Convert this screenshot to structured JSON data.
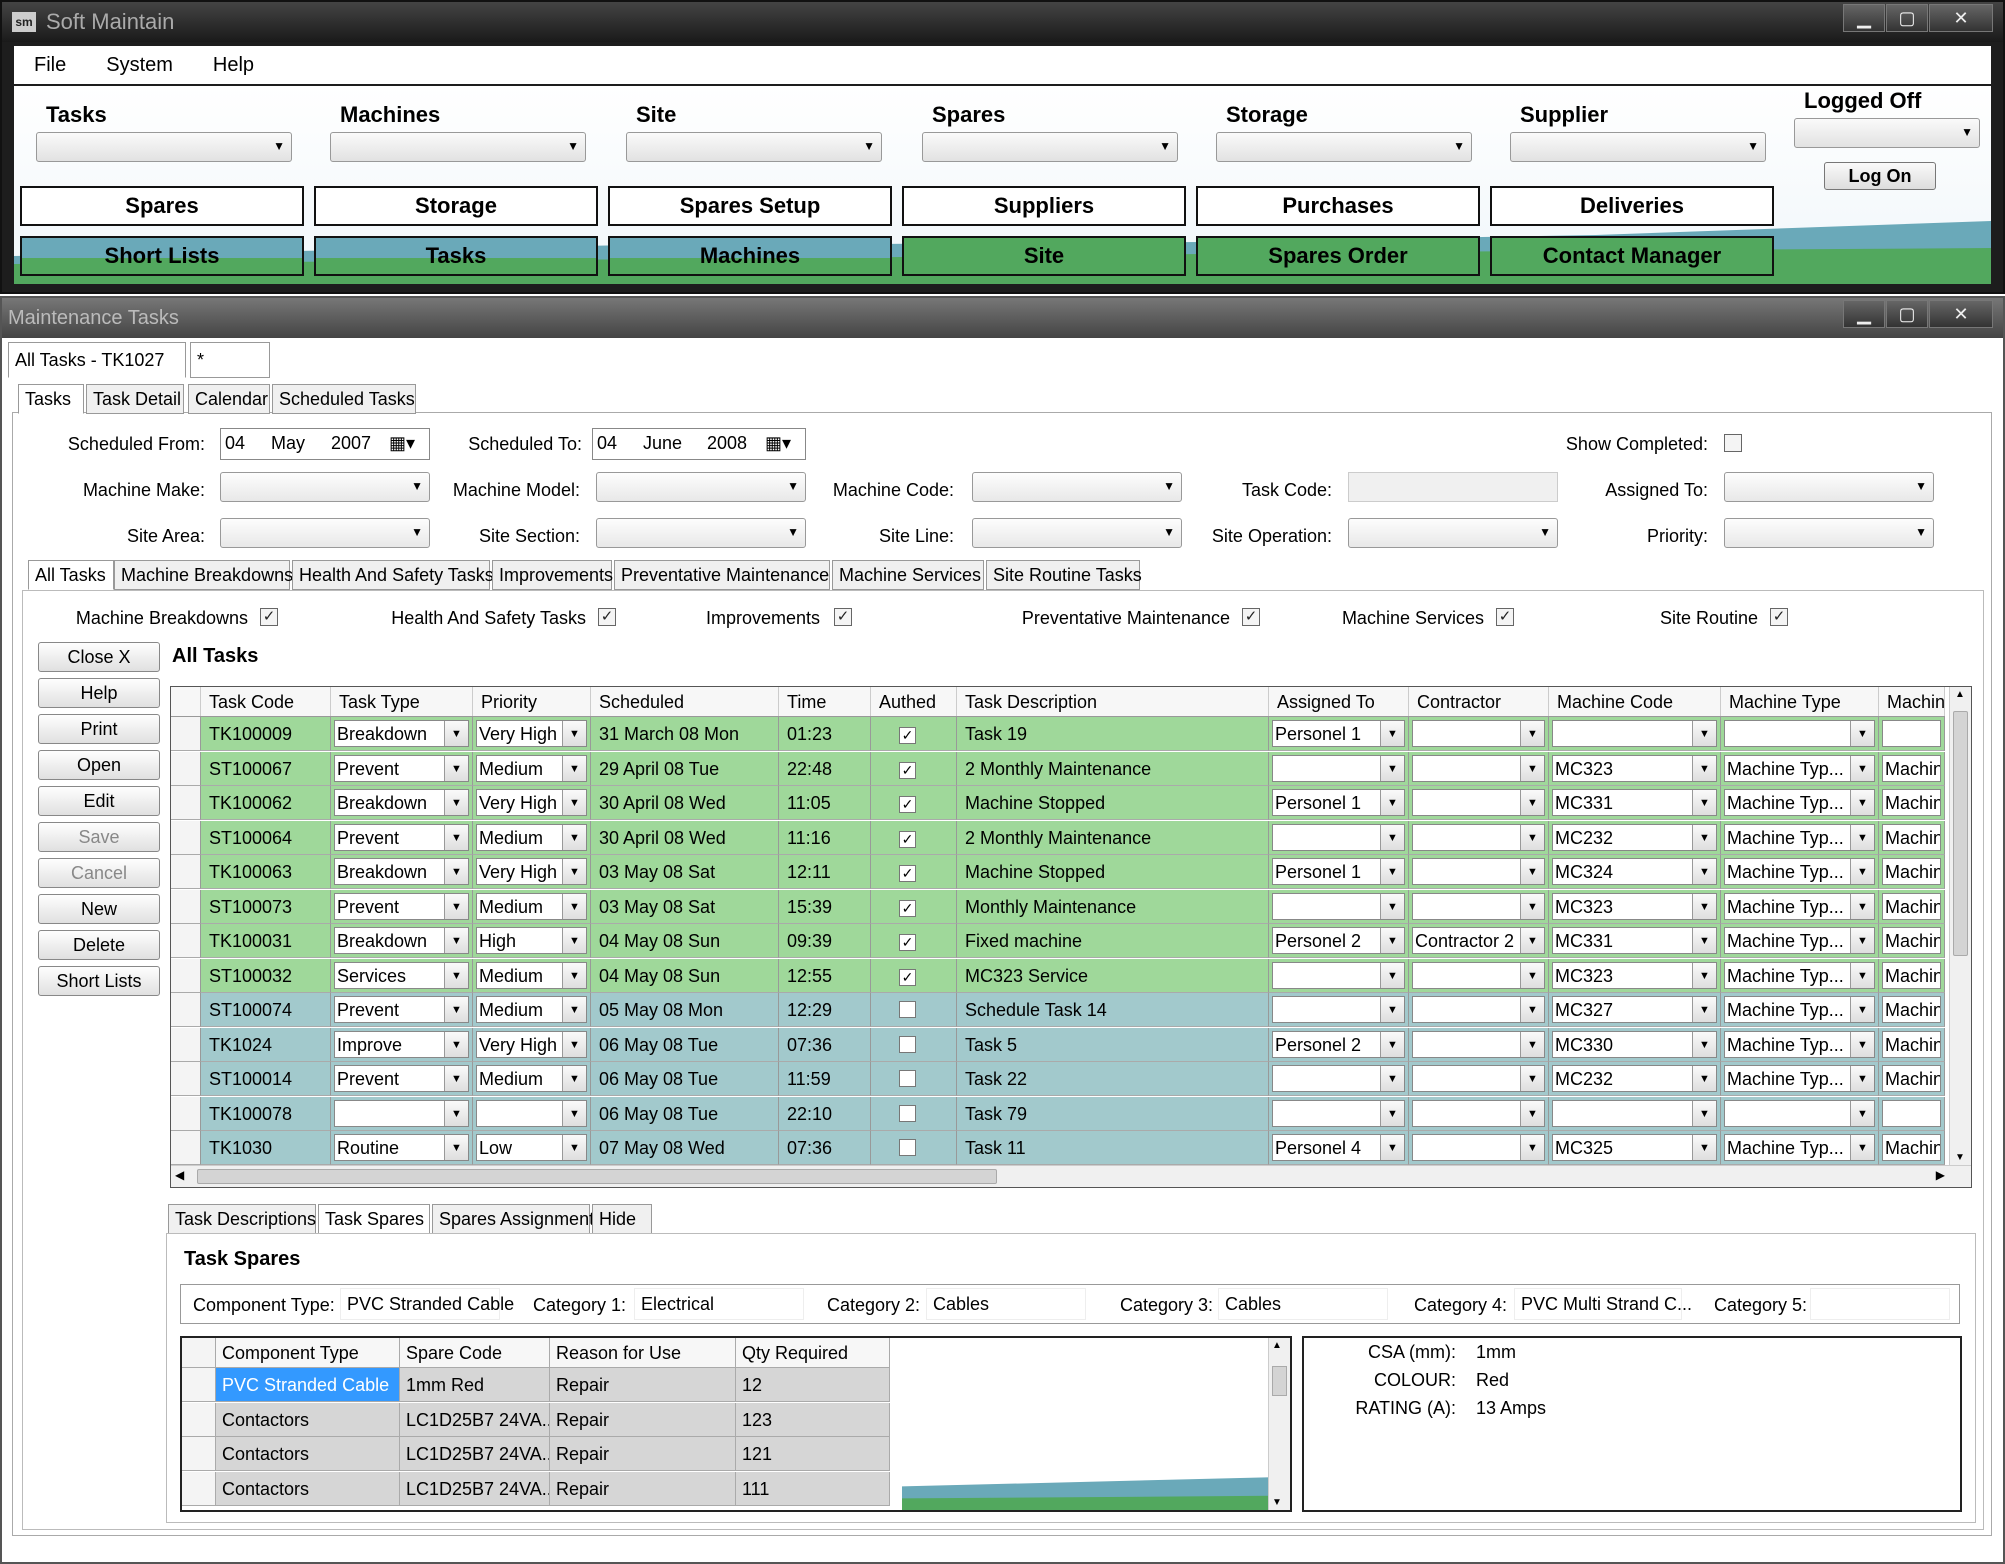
{
  "app": {
    "title": "Soft Maintain",
    "icon": "sm"
  },
  "menu": [
    "File",
    "System",
    "Help"
  ],
  "top": {
    "dropdowns": [
      "Tasks",
      "Machines",
      "Site",
      "Spares",
      "Storage",
      "Supplier"
    ],
    "logged_label": "Logged Off",
    "logon_button": "Log On",
    "row1": [
      "Spares",
      "Storage",
      "Spares Setup",
      "Suppliers",
      "Purchases",
      "Deliveries"
    ],
    "row2": [
      "Short Lists",
      "Tasks",
      "Machines",
      "Site",
      "Spares Order",
      "Contact Manager"
    ]
  },
  "window2": {
    "title": "Maintenance Tasks",
    "doc_tabs": [
      "All Tasks - TK1027",
      "*"
    ],
    "tabs": [
      "Tasks",
      "Task Detail",
      "Calendar",
      "Scheduled Tasks"
    ]
  },
  "filters": {
    "scheduled_from_label": "Scheduled From:",
    "scheduled_from": {
      "day": "04",
      "month": "May",
      "year": "2007"
    },
    "scheduled_to_label": "Scheduled To:",
    "scheduled_to": {
      "day": "04",
      "month": "June",
      "year": "2008"
    },
    "show_completed_label": "Show Completed:",
    "machine_make": "Machine Make:",
    "machine_model": "Machine Model:",
    "machine_code": "Machine Code:",
    "task_code": "Task Code:",
    "assigned_to": "Assigned To:",
    "site_area": "Site Area:",
    "site_section": "Site Section:",
    "site_line": "Site Line:",
    "site_operation": "Site Operation:",
    "priority": "Priority:"
  },
  "subtabs": [
    "All Tasks",
    "Machine Breakdowns",
    "Health And Safety Tasks",
    "Improvements",
    "Preventative Maintenance",
    "Machine Services",
    "Site Routine Tasks"
  ],
  "type_checks": [
    "Machine Breakdowns",
    "Health And Safety Tasks",
    "Improvements",
    "Preventative Maintenance",
    "Machine Services",
    "Site Routine"
  ],
  "side_buttons": [
    "Close X",
    "Help",
    "Print",
    "Open",
    "Edit",
    "Save",
    "Cancel",
    "New",
    "Delete",
    "Short Lists"
  ],
  "grid_title": "All Tasks",
  "columns": [
    "Task Code",
    "Task Type",
    "Priority",
    "Scheduled",
    "Time",
    "Authed",
    "Task Description",
    "Assigned To",
    "Contractor",
    "Machine Code",
    "Machine Type",
    "Machine"
  ],
  "rows": [
    {
      "code": "TK100009",
      "type": "Breakdown",
      "priority": "Very High",
      "scheduled": "31 March 08 Mon",
      "time": "01:23",
      "authed": true,
      "desc": "Task 19",
      "assigned": "Personel 1",
      "contractor": "",
      "mcode": "",
      "mtype": "",
      "m": "",
      "color": "green"
    },
    {
      "code": "ST100067",
      "type": "Prevent",
      "priority": "Medium",
      "scheduled": "29 April 08 Tue",
      "time": "22:48",
      "authed": true,
      "desc": "2 Monthly Maintenance",
      "assigned": "",
      "contractor": "",
      "mcode": "MC323",
      "mtype": "Machine Typ...",
      "m": "Machine",
      "color": "green"
    },
    {
      "code": "TK100062",
      "type": "Breakdown",
      "priority": "Very High",
      "scheduled": "30 April 08 Wed",
      "time": "11:05",
      "authed": true,
      "desc": "Machine Stopped",
      "assigned": "Personel 1",
      "contractor": "",
      "mcode": "MC331",
      "mtype": "Machine Typ...",
      "m": "Machine",
      "color": "green"
    },
    {
      "code": "ST100064",
      "type": "Prevent",
      "priority": "Medium",
      "scheduled": "30 April 08 Wed",
      "time": "11:16",
      "authed": true,
      "desc": "2 Monthly Maintenance",
      "assigned": "",
      "contractor": "",
      "mcode": "MC232",
      "mtype": "Machine Typ...",
      "m": "Machine",
      "color": "green"
    },
    {
      "code": "TK100063",
      "type": "Breakdown",
      "priority": "Very High",
      "scheduled": "03 May 08 Sat",
      "time": "12:11",
      "authed": true,
      "desc": "Machine Stopped",
      "assigned": "Personel 1",
      "contractor": "",
      "mcode": "MC324",
      "mtype": "Machine Typ...",
      "m": "Machine",
      "color": "green"
    },
    {
      "code": "ST100073",
      "type": "Prevent",
      "priority": "Medium",
      "scheduled": "03 May 08 Sat",
      "time": "15:39",
      "authed": true,
      "desc": "Monthly Maintenance",
      "assigned": "",
      "contractor": "",
      "mcode": "MC323",
      "mtype": "Machine Typ...",
      "m": "Machine",
      "color": "green"
    },
    {
      "code": "TK100031",
      "type": "Breakdown",
      "priority": "High",
      "scheduled": "04 May 08 Sun",
      "time": "09:39",
      "authed": true,
      "desc": "Fixed machine",
      "assigned": "Personel 2",
      "contractor": "Contractor 2",
      "mcode": "MC331",
      "mtype": "Machine Typ...",
      "m": "Machine",
      "color": "green"
    },
    {
      "code": "ST100032",
      "type": "Services",
      "priority": "Medium",
      "scheduled": "04 May 08 Sun",
      "time": "12:55",
      "authed": true,
      "desc": "MC323 Service",
      "assigned": "",
      "contractor": "",
      "mcode": "MC323",
      "mtype": "Machine Typ...",
      "m": "Machine",
      "color": "green"
    },
    {
      "code": "ST100074",
      "type": "Prevent",
      "priority": "Medium",
      "scheduled": "05 May 08 Mon",
      "time": "12:29",
      "authed": false,
      "desc": "Schedule Task 14",
      "assigned": "",
      "contractor": "",
      "mcode": "MC327",
      "mtype": "Machine Typ...",
      "m": "Machine",
      "color": "teal"
    },
    {
      "code": "TK1024",
      "type": "Improve",
      "priority": "Very High",
      "scheduled": "06 May 08 Tue",
      "time": "07:36",
      "authed": false,
      "desc": "Task 5",
      "assigned": "Personel 2",
      "contractor": "",
      "mcode": "MC330",
      "mtype": "Machine Typ...",
      "m": "Machine",
      "color": "teal"
    },
    {
      "code": "ST100014",
      "type": "Prevent",
      "priority": "Medium",
      "scheduled": "06 May 08 Tue",
      "time": "11:59",
      "authed": false,
      "desc": "Task 22",
      "assigned": "",
      "contractor": "",
      "mcode": "MC232",
      "mtype": "Machine Typ...",
      "m": "Machine",
      "color": "teal"
    },
    {
      "code": "TK100078",
      "type": "",
      "priority": "",
      "scheduled": "06 May 08 Tue",
      "time": "22:10",
      "authed": false,
      "desc": "Task 79",
      "assigned": "",
      "contractor": "",
      "mcode": "",
      "mtype": "",
      "m": "",
      "color": "teal"
    },
    {
      "code": "TK1030",
      "type": "Routine",
      "priority": "Low",
      "scheduled": "07 May 08 Wed",
      "time": "07:36",
      "authed": false,
      "desc": "Task 11",
      "assigned": "Personel 4",
      "contractor": "",
      "mcode": "MC325",
      "mtype": "Machine Typ...",
      "m": "Machine",
      "color": "teal"
    }
  ],
  "bottom_tabs": [
    "Task Descriptions",
    "Task Spares",
    "Spares Assignment",
    "Hide"
  ],
  "task_spares": {
    "title": "Task Spares",
    "component_type_label": "Component Type:",
    "component_type": "PVC Stranded Cable",
    "cat1_label": "Category 1:",
    "cat1": "Electrical",
    "cat2_label": "Category 2:",
    "cat2": "Cables",
    "cat3_label": "Category 3:",
    "cat3": "Cables",
    "cat4_label": "Category 4:",
    "cat4": "PVC Multi Strand C...",
    "cat5_label": "Category 5:",
    "cat5": "",
    "columns": [
      "Component Type",
      "Spare Code",
      "Reason for Use",
      "Qty Required"
    ],
    "rows": [
      [
        "PVC Stranded Cable",
        "1mm Red",
        "Repair",
        "12"
      ],
      [
        "Contactors",
        "LC1D25B7 24VA...",
        "Repair",
        "123"
      ],
      [
        "Contactors",
        "LC1D25B7 24VA...",
        "Repair",
        "121"
      ],
      [
        "Contactors",
        "LC1D25B7 24VA...",
        "Repair",
        "111"
      ]
    ],
    "props": [
      {
        "label": "CSA (mm):",
        "value": "1mm"
      },
      {
        "label": "COLOUR:",
        "value": "Red"
      },
      {
        "label": "RATING (A):",
        "value": "13 Amps"
      }
    ]
  },
  "colors": {
    "green_row": "#9fd89a",
    "teal_row": "#a2c9cc",
    "selected": "#3399ff",
    "accent_green": "#52a85e",
    "accent_sea": "#6aa9b9"
  }
}
